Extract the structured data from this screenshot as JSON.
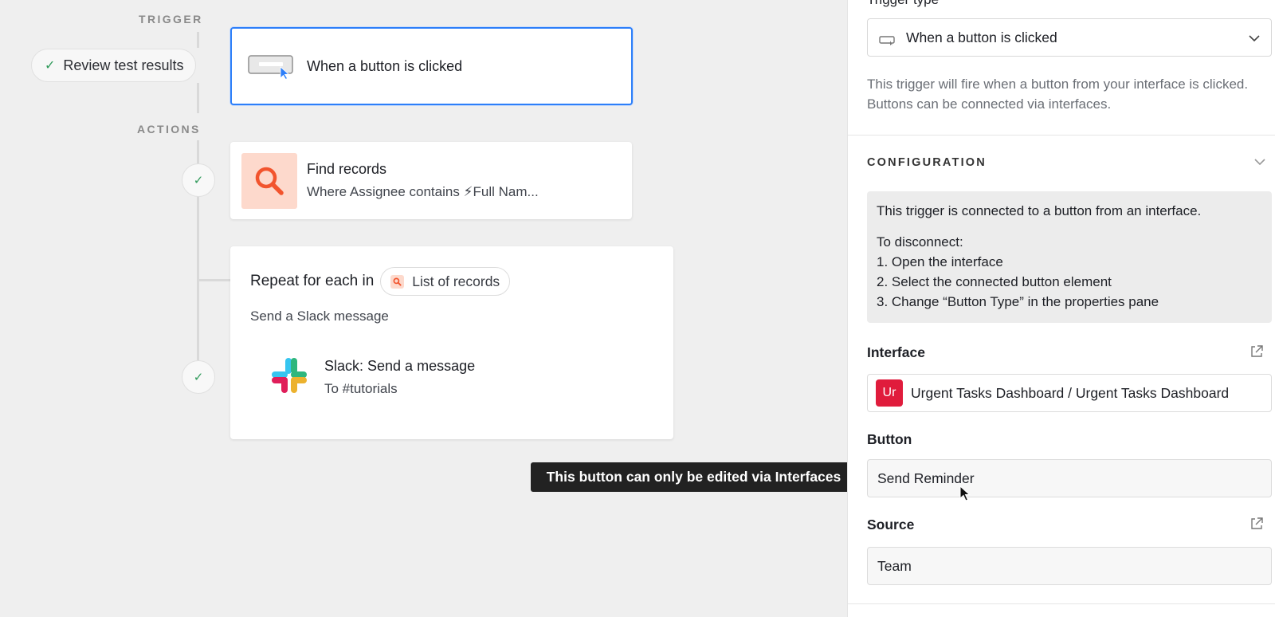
{
  "canvas": {
    "trigger_label": "TRIGGER",
    "actions_label": "ACTIONS",
    "review_pill": "Review test results",
    "trigger_card": {
      "title": "When a button is clicked"
    },
    "find_card": {
      "title": "Find records",
      "subtitle": "Where Assignee contains ⚡Full Nam..."
    },
    "repeat_card": {
      "prefix": "Repeat for each in",
      "chip": "List of records",
      "subtitle": "Send a Slack message",
      "slack_title": "Slack: Send a message",
      "slack_subtitle": "To #tutorials"
    },
    "tooltip": "This button can only be edited via Interfaces"
  },
  "panel": {
    "trigger_type_label": "Trigger type",
    "trigger_type_value": "When a button is clicked",
    "description": "This trigger will fire when a button from your interface is clicked. Buttons can be connected via interfaces.",
    "configuration_heading": "CONFIGURATION",
    "info": {
      "line1": "This trigger is connected to a button from an interface.",
      "disconnect": "To disconnect:",
      "step1": "1. Open the interface",
      "step2": "2. Select the connected button element",
      "step3": "3. Change “Button Type” in the properties pane"
    },
    "interface_label": "Interface",
    "interface_badge": "Ur",
    "interface_value": "Urgent Tasks Dashboard / Urgent Tasks Dashboard",
    "button_label": "Button",
    "button_value": "Send Reminder",
    "source_label": "Source",
    "source_value": "Team"
  },
  "colors": {
    "accent": "#2d7ff9",
    "success": "#2f9a5a",
    "find_icon": "#f2542d",
    "interface_badge": "#e01c3c"
  }
}
